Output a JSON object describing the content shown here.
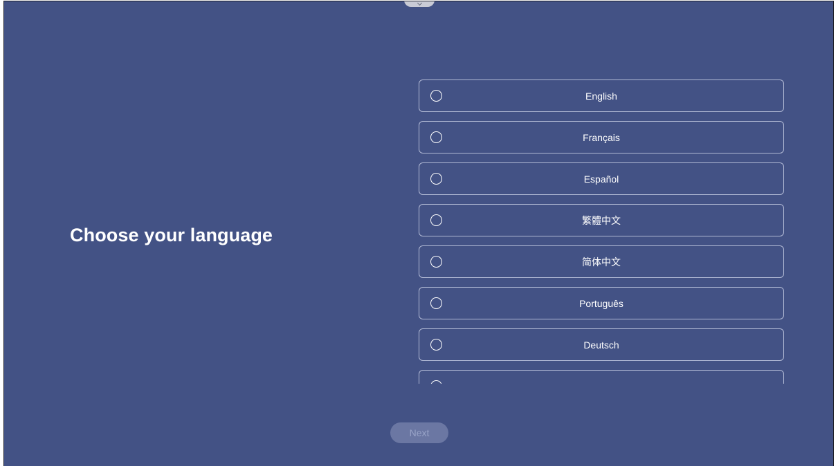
{
  "page": {
    "title": "Choose your language",
    "background_color": "#435285"
  },
  "top_handle": {
    "icon": "chevron-down-icon"
  },
  "languages": [
    {
      "label": "English",
      "selected": false
    },
    {
      "label": "Français",
      "selected": false
    },
    {
      "label": "Español",
      "selected": false
    },
    {
      "label": "繁體中文",
      "selected": false
    },
    {
      "label": "简体中文",
      "selected": false
    },
    {
      "label": "Português",
      "selected": false
    },
    {
      "label": "Deutsch",
      "selected": false
    },
    {
      "label": "",
      "selected": false
    }
  ],
  "footer": {
    "next_label": "Next",
    "next_enabled": false
  }
}
